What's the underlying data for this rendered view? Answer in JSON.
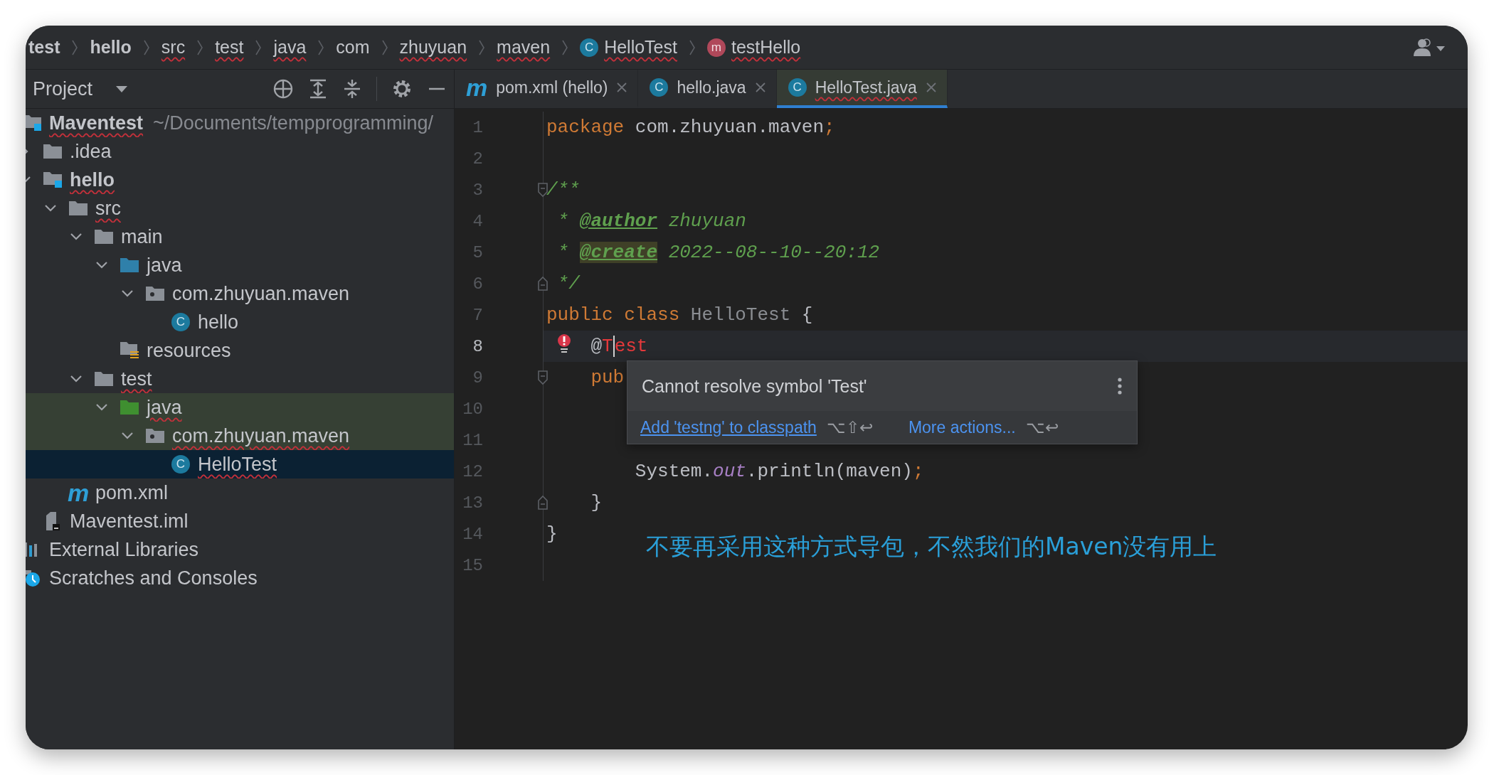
{
  "breadcrumbs": [
    {
      "label": "test",
      "kind": "module",
      "typo": false
    },
    {
      "label": "hello",
      "kind": "module",
      "typo": false
    },
    {
      "label": "src",
      "kind": "dir",
      "typo": true
    },
    {
      "label": "test",
      "kind": "dir",
      "typo": true
    },
    {
      "label": "java",
      "kind": "dir",
      "typo": true
    },
    {
      "label": "com",
      "kind": "dir",
      "typo": false
    },
    {
      "label": "zhuyuan",
      "kind": "dir",
      "typo": true
    },
    {
      "label": "maven",
      "kind": "dir",
      "typo": true
    },
    {
      "label": "HelloTest",
      "kind": "class",
      "badge": "C",
      "typo": true
    },
    {
      "label": "testHello",
      "kind": "method",
      "badge": "m",
      "typo": true
    }
  ],
  "sidebar": {
    "title": "Project"
  },
  "tree": [
    {
      "label": "Maventest",
      "kind": "module",
      "note": "~/Documents/tempprogramming/",
      "typo": true,
      "selected": false,
      "tinted": false,
      "children": [
        {
          "label": ".idea",
          "kind": "folder",
          "typo": false,
          "expanded": false,
          "selected": false,
          "tinted": false
        },
        {
          "label": "hello",
          "kind": "module",
          "typo": true,
          "expanded": true,
          "selected": false,
          "tinted": false,
          "children": [
            {
              "label": "src",
              "kind": "folder",
              "typo": true,
              "expanded": true,
              "selected": false,
              "tinted": false,
              "children": [
                {
                  "label": "main",
                  "kind": "folder",
                  "typo": false,
                  "expanded": true,
                  "selected": false,
                  "tinted": false,
                  "children": [
                    {
                      "label": "java",
                      "kind": "source",
                      "typo": false,
                      "expanded": true,
                      "selected": false,
                      "tinted": false,
                      "children": [
                        {
                          "label": "com.zhuyuan.maven",
                          "kind": "package",
                          "typo": false,
                          "expanded": true,
                          "selected": false,
                          "tinted": false,
                          "children": [
                            {
                              "label": "hello",
                              "kind": "class",
                              "badge": "C",
                              "typo": false,
                              "selected": false,
                              "tinted": false
                            }
                          ]
                        }
                      ]
                    },
                    {
                      "label": "resources",
                      "kind": "resources",
                      "typo": false,
                      "selected": false,
                      "tinted": false
                    }
                  ]
                },
                {
                  "label": "test",
                  "kind": "folder",
                  "typo": true,
                  "expanded": true,
                  "selected": false,
                  "tinted": false,
                  "children": [
                    {
                      "label": "java",
                      "kind": "test-source",
                      "typo": true,
                      "expanded": true,
                      "selected": false,
                      "tinted": true,
                      "children": [
                        {
                          "label": "com.zhuyuan.maven",
                          "kind": "package",
                          "typo": true,
                          "expanded": true,
                          "selected": false,
                          "tinted": true,
                          "children": [
                            {
                              "label": "HelloTest",
                              "kind": "class",
                              "badge": "C",
                              "typo": true,
                              "selected": true,
                              "tinted": false
                            }
                          ]
                        }
                      ]
                    }
                  ]
                }
              ]
            },
            {
              "label": "pom.xml",
              "kind": "maven",
              "badge": "m",
              "typo": false,
              "selected": false,
              "tinted": false
            }
          ]
        },
        {
          "label": "Maventest.iml",
          "kind": "iml",
          "typo": false,
          "selected": false,
          "tinted": false
        }
      ]
    },
    {
      "label": "External Libraries",
      "kind": "libraries",
      "typo": false,
      "selected": false,
      "tinted": false
    },
    {
      "label": "Scratches and Consoles",
      "kind": "scratches",
      "typo": false,
      "selected": false,
      "tinted": false
    }
  ],
  "tabs": [
    {
      "label": "pom.xml (hello)",
      "kind": "maven",
      "badge": "m",
      "typo": false,
      "selected": false
    },
    {
      "label": "hello.java",
      "kind": "class",
      "badge": "C",
      "typo": false,
      "selected": false
    },
    {
      "label": "HelloTest.java",
      "kind": "class",
      "badge": "C",
      "typo": true,
      "selected": true
    }
  ],
  "lines": [
    {
      "number": "1",
      "current": false,
      "tokens": [
        {
          "kind": "keyword",
          "text": "package"
        },
        {
          "kind": "plain",
          "text": " com.zhuyuan.maven"
        },
        {
          "kind": "punct",
          "text": ";"
        }
      ]
    },
    {
      "number": "2",
      "current": false
    },
    {
      "number": "3",
      "current": false,
      "marker": {
        "kind": "fold-start"
      },
      "tokens": [
        {
          "kind": "comment",
          "text": "/**"
        }
      ]
    },
    {
      "number": "4",
      "current": false,
      "tokens": [
        {
          "kind": "comment",
          "text": " * "
        },
        {
          "kind": "tag",
          "text": "@author"
        },
        {
          "kind": "comment",
          "text": " zhuyuan"
        }
      ]
    },
    {
      "number": "5",
      "current": false,
      "tokens": [
        {
          "kind": "comment",
          "text": " * "
        },
        {
          "kind": "tag-marked",
          "text": "@create"
        },
        {
          "kind": "comment",
          "text": " 2022--08--10--20:12"
        }
      ]
    },
    {
      "number": "6",
      "current": false,
      "marker": {
        "kind": "fold-end"
      },
      "tokens": [
        {
          "kind": "comment",
          "text": " */"
        }
      ]
    },
    {
      "number": "7",
      "current": false,
      "tokens": [
        {
          "kind": "keyword",
          "text": "public class"
        },
        {
          "kind": "unused",
          "text": " HelloTest"
        },
        {
          "kind": "plain",
          "text": " {"
        }
      ]
    },
    {
      "number": "8",
      "current": true,
      "marker": {
        "kind": "error"
      },
      "tokens": [
        {
          "kind": "plain",
          "text": "    @"
        },
        {
          "kind": "error",
          "text": "T"
        },
        {
          "kind": "caret"
        },
        {
          "kind": "error",
          "text": "est"
        }
      ]
    },
    {
      "number": "9",
      "current": false,
      "marker": {
        "kind": "fold-start"
      },
      "tokens": [
        {
          "kind": "keyword",
          "text": "    pub"
        }
      ]
    },
    {
      "number": "10",
      "current": false
    },
    {
      "number": "11",
      "current": false
    },
    {
      "number": "12",
      "current": false,
      "tokens": [
        {
          "kind": "plain",
          "text": "        System."
        },
        {
          "kind": "field",
          "text": "out"
        },
        {
          "kind": "plain",
          "text": ".println(maven)"
        },
        {
          "kind": "punct",
          "text": ";"
        }
      ]
    },
    {
      "number": "13",
      "current": false,
      "marker": {
        "kind": "fold-end"
      },
      "tokens": [
        {
          "kind": "plain",
          "text": "    }"
        }
      ]
    },
    {
      "number": "14",
      "current": false,
      "tokens": [
        {
          "kind": "plain",
          "text": "}"
        }
      ]
    },
    {
      "number": "15",
      "current": false
    }
  ],
  "popup": {
    "message": "Cannot resolve symbol 'Test'",
    "actions": [
      {
        "label": "Add 'testng' to classpath",
        "shortcut": "⌥⇧↩",
        "kind": "primary"
      },
      {
        "label": "More actions...",
        "shortcut": "⌥↩",
        "kind": "secondary"
      }
    ]
  },
  "annotation": "不要再采用这种方式导包，不然我们的Maven没有用上"
}
